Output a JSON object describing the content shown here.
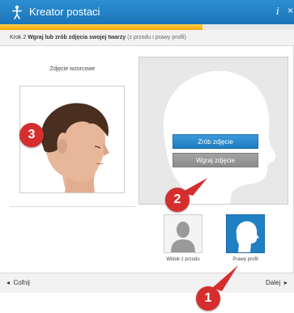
{
  "app": {
    "title": "Kreator postaci",
    "info_label": "i",
    "close_label": "×"
  },
  "progress": {
    "fraction": 0.69
  },
  "step": {
    "prefix": "Krok 2",
    "instruction": "Wgraj lub zrób zdjęcia swojej twarzy",
    "hint": "(z przodu i prawy profil)"
  },
  "sample": {
    "label": "Zdjęcie wzorcowe"
  },
  "preview": {
    "take_photo": "Zrób zdjęcie",
    "upload_photo": "Wgraj zdjęcie"
  },
  "views": [
    {
      "label": "Widok z przodu",
      "selected": false
    },
    {
      "label": "Prawy profil",
      "selected": true
    }
  ],
  "footer": {
    "back": "Cofnij",
    "next": "Dalej"
  },
  "badges": [
    "1",
    "2",
    "3"
  ],
  "colors": {
    "accent": "#1f80c4",
    "badge": "#d62e2e",
    "progress": "#f2a500"
  },
  "icons": [
    "person-logo-icon",
    "head-silhouette-icon",
    "chevron-left-icon",
    "chevron-right-icon"
  ]
}
